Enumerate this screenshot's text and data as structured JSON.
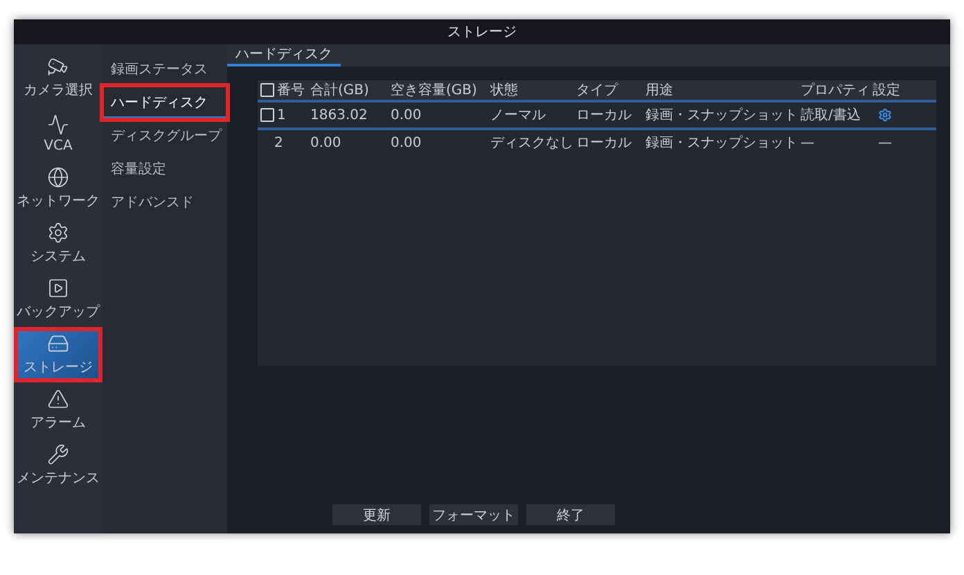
{
  "window": {
    "title": "ストレージ"
  },
  "nav": [
    {
      "label": "カメラ選択",
      "selected": false,
      "highlighted": false
    },
    {
      "label": "VCA",
      "selected": false,
      "highlighted": false
    },
    {
      "label": "ネットワーク",
      "selected": false,
      "highlighted": false
    },
    {
      "label": "システム",
      "selected": false,
      "highlighted": false
    },
    {
      "label": "バックアップ",
      "selected": false,
      "highlighted": false
    },
    {
      "label": "ストレージ",
      "selected": true,
      "highlighted": true
    },
    {
      "label": "アラーム",
      "selected": false,
      "highlighted": false
    },
    {
      "label": "メンテナンス",
      "selected": false,
      "highlighted": false
    }
  ],
  "submenu": [
    {
      "label": "録画ステータス",
      "selected": false,
      "highlighted": false
    },
    {
      "label": "ハードディスク",
      "selected": true,
      "highlighted": true
    },
    {
      "label": "ディスクグループ",
      "selected": false,
      "highlighted": false
    },
    {
      "label": "容量設定",
      "selected": false,
      "highlighted": false
    },
    {
      "label": "アドバンスド",
      "selected": false,
      "highlighted": false
    }
  ],
  "tabs": [
    {
      "label": "ハードディスク",
      "selected": true
    }
  ],
  "table": {
    "header_checked": false,
    "columns": [
      "番号",
      "合計(GB)",
      "空き容量(GB)",
      "状態",
      "タイプ",
      "用途",
      "プロパティ",
      "設定"
    ],
    "rows": [
      {
        "checkbox": true,
        "checked": false,
        "selected": true,
        "cells": [
          "1",
          "1863.02",
          "0.00",
          "ノーマル",
          "ローカル",
          "録画・スナップショット",
          "読取/書込"
        ],
        "settings": {
          "kind": "gear"
        }
      },
      {
        "checkbox": false,
        "selected": false,
        "cells": [
          "2",
          "0.00",
          "0.00",
          "ディスクなし",
          "ローカル",
          "録画・スナップショット",
          "—"
        ],
        "settings": {
          "kind": "text",
          "text": "—"
        }
      }
    ]
  },
  "buttons": [
    "更新",
    "フォーマット",
    "終了"
  ]
}
